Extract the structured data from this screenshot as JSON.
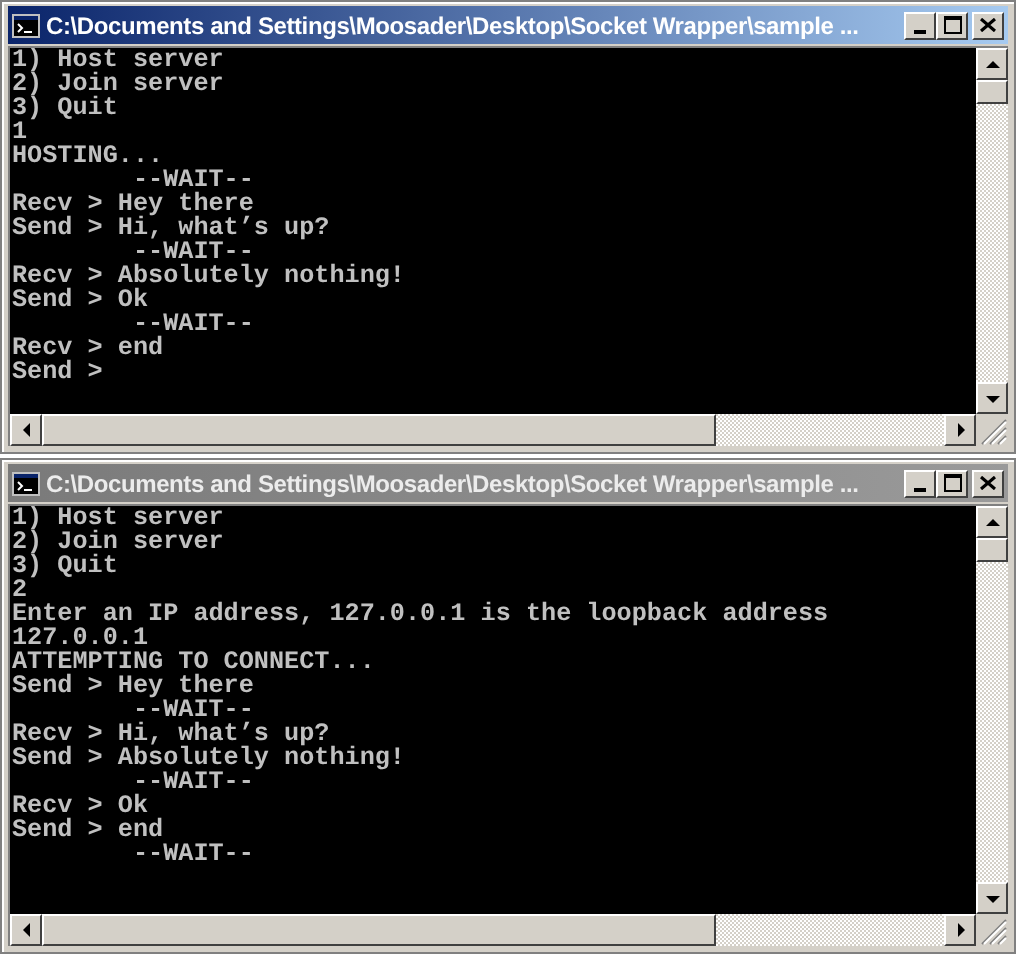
{
  "windows": [
    {
      "title": "C:\\Documents and Settings\\Moosader\\Desktop\\Socket Wrapper\\sample ...",
      "active": true,
      "lines": [
        "1) Host server",
        "2) Join server",
        "3) Quit",
        "1",
        "HOSTING...",
        "        --WAIT--",
        "Recv > Hey there",
        "Send > Hi, what’s up?",
        "        --WAIT--",
        "Recv > Absolutely nothing!",
        "Send > Ok",
        "        --WAIT--",
        "Recv > end",
        "Send >"
      ]
    },
    {
      "title": "C:\\Documents and Settings\\Moosader\\Desktop\\Socket Wrapper\\sample ...",
      "active": false,
      "lines": [
        "1) Host server",
        "2) Join server",
        "3) Quit",
        "2",
        "Enter an IP address, 127.0.0.1 is the loopback address",
        "127.0.0.1",
        "ATTEMPTING TO CONNECT...",
        "Send > Hey there",
        "        --WAIT--",
        "Recv > Hi, what’s up?",
        "Send > Absolutely nothing!",
        "        --WAIT--",
        "Recv > Ok",
        "Send > end",
        "        --WAIT--"
      ]
    }
  ]
}
